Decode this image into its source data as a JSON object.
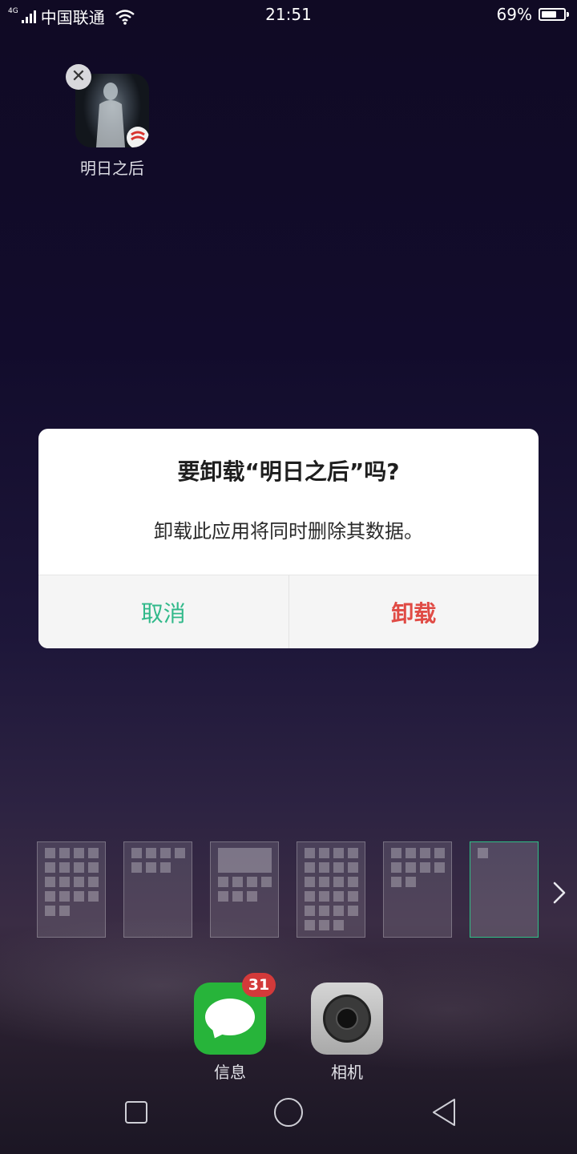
{
  "status_bar": {
    "network_type": "4G",
    "carrier": "中国联通",
    "time": "21:51",
    "battery_percent": "69%",
    "battery_level": 0.69
  },
  "home_app": {
    "label": "明日之后",
    "remove_icon": "close-icon"
  },
  "dialog": {
    "title": "要卸载“明日之后”吗?",
    "message": "卸载此应用将同时删除其数据。",
    "cancel_label": "取消",
    "confirm_label": "卸载",
    "cancel_color": "#31b98a",
    "confirm_color": "#e04b45"
  },
  "page_thumbnails": {
    "count": 6,
    "active_index": 5,
    "next_icon": "chevron-right-icon",
    "active_color": "#2fbf86"
  },
  "dock": {
    "apps": [
      {
        "label": "信息",
        "icon": "message-bubble-icon",
        "badge": "31"
      },
      {
        "label": "相机",
        "icon": "camera-lens-icon"
      }
    ]
  },
  "nav_bar": {
    "buttons": [
      "recents-square-icon",
      "home-circle-icon",
      "back-triangle-icon"
    ]
  }
}
